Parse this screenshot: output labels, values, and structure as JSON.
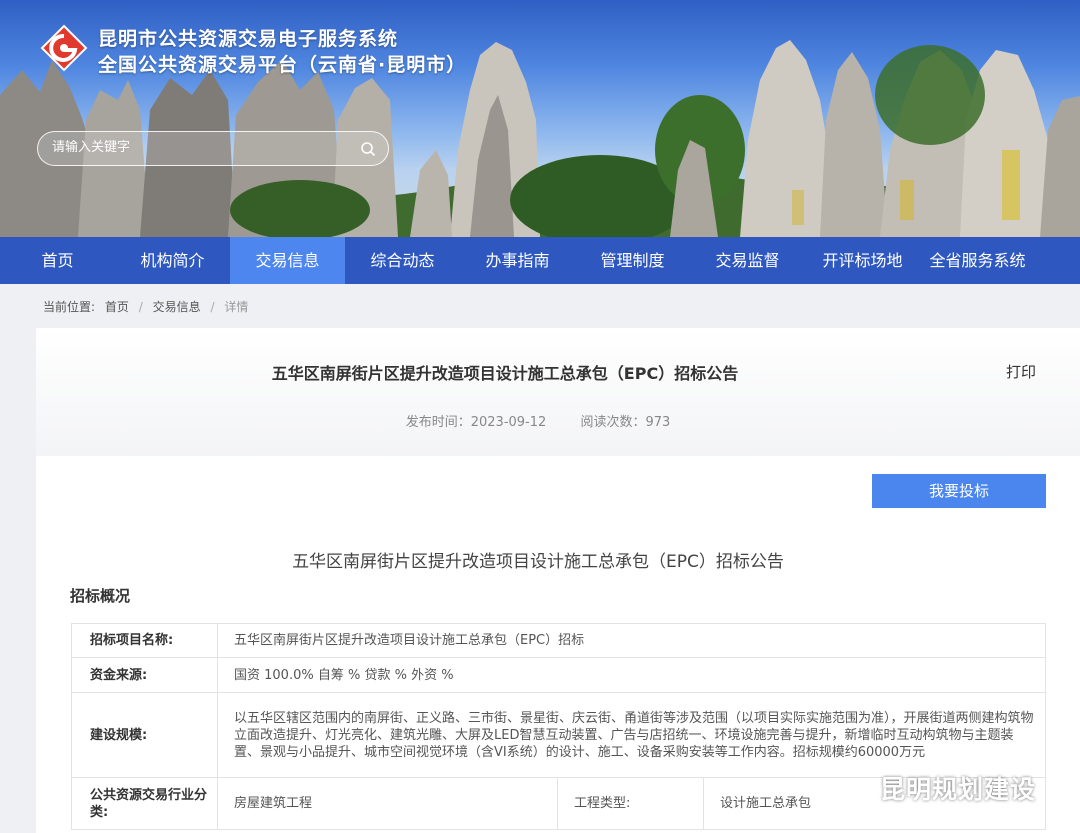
{
  "site": {
    "title_line1": "昆明市公共资源交易电子服务系统",
    "title_line2": "全国公共资源交易平台（云南省·昆明市）",
    "search_placeholder": "请输入关键字"
  },
  "nav": {
    "items": [
      "首页",
      "机构简介",
      "交易信息",
      "综合动态",
      "办事指南",
      "管理制度",
      "交易监督",
      "开评标场地",
      "全省服务系统"
    ],
    "active_index": 2
  },
  "breadcrumb": {
    "label": "当前位置:",
    "items": [
      "首页",
      "交易信息",
      "详情"
    ],
    "separator": "/"
  },
  "article": {
    "title": "五华区南屏街片区提升改造项目设计施工总承包（EPC）招标公告",
    "print_label": "打印",
    "publish_label": "发布时间：2023-09-12",
    "views_label": "阅读次数：973",
    "bid_button": "我要投标",
    "doc_title": "五华区南屏街片区提升改造项目设计施工总承包（EPC）招标公告",
    "section_title": "招标概况",
    "table": {
      "project_name_key": "招标项目名称:",
      "project_name_val": "五华区南屏街片区提升改造项目设计施工总承包（EPC）招标",
      "funding_key": "资金来源:",
      "funding_val": "国资 100.0% 自筹 % 贷款 % 外资 %",
      "scale_key": "建设规模:",
      "scale_val": "以五华区辖区范围内的南屏街、正义路、三市街、景星街、庆云街、甬道街等涉及范围（以项目实际实施范围为准），开展街道两侧建构筑物立面改造提升、灯光亮化、建筑光雕、大屏及LED智慧互动装置、广告与店招统一、环境设施完善与提升，新增临时互动构筑物与主题装置、景观与小品提升、城市空间视觉环境（含VI系统）的设计、施工、设备采购安装等工作内容。招标规模约60000万元",
      "category_key": "公共资源交易行业分类:",
      "category_val": "房屋建筑工程",
      "type_key": "工程类型:",
      "type_val": "设计施工总承包"
    }
  },
  "watermark": "昆明规划建设",
  "colors": {
    "nav_bg": "#2e58c0",
    "nav_active": "#4d86ef",
    "button": "#4a86ee",
    "logo_red": "#e03a2f"
  },
  "icons": [
    "logo-icon",
    "search-icon",
    "wechat-icon"
  ]
}
